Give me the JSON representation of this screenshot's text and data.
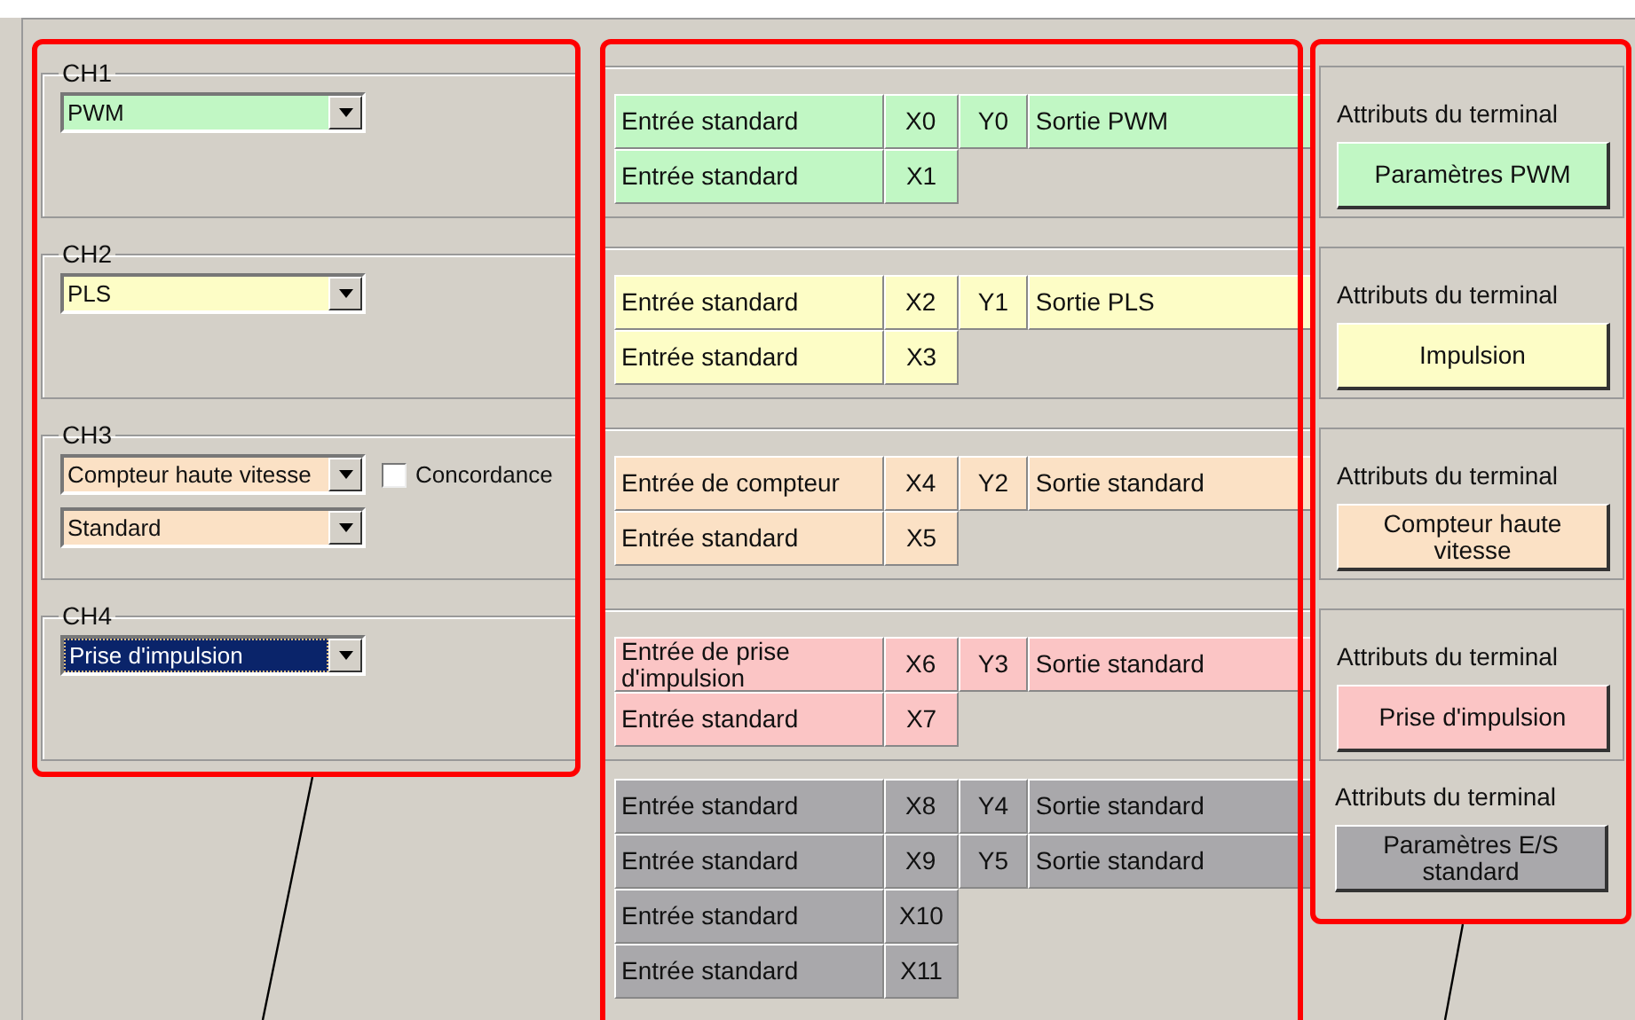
{
  "channels": [
    {
      "name": "CH1",
      "color": "#c1f7c4",
      "selects": [
        {
          "value": "PWM",
          "focused": false
        }
      ],
      "pins": [
        {
          "input": "Entrée standard",
          "x": "X0",
          "y": "Y0",
          "output": "Sortie PWM"
        },
        {
          "input": "Entrée standard",
          "x": "X1"
        }
      ],
      "attributes_label": "Attributs du terminal",
      "button": "Paramètres PWM"
    },
    {
      "name": "CH2",
      "color": "#fdfdc6",
      "selects": [
        {
          "value": "PLS",
          "focused": false
        }
      ],
      "pins": [
        {
          "input": "Entrée standard",
          "x": "X2",
          "y": "Y1",
          "output": "Sortie PLS"
        },
        {
          "input": "Entrée standard",
          "x": "X3"
        }
      ],
      "attributes_label": "Attributs du terminal",
      "button": "Impulsion"
    },
    {
      "name": "CH3",
      "color": "#fbe1c5",
      "selects": [
        {
          "value": "Compteur haute vitesse",
          "focused": false
        },
        {
          "value": "Standard",
          "focused": false
        }
      ],
      "checkbox": {
        "label": "Concordance",
        "checked": false
      },
      "pins": [
        {
          "input": "Entrée de compteur",
          "x": "X4",
          "y": "Y2",
          "output": "Sortie standard"
        },
        {
          "input": "Entrée standard",
          "x": "X5"
        }
      ],
      "attributes_label": "Attributs du terminal",
      "button": "Compteur haute vitesse"
    },
    {
      "name": "CH4",
      "color": "#fbc5c5",
      "selects": [
        {
          "value": "Prise d'impulsion",
          "focused": true
        }
      ],
      "pins": [
        {
          "input": "Entrée de prise d'impulsion",
          "x": "X6",
          "y": "Y3",
          "output": "Sortie standard"
        },
        {
          "input": "Entrée standard",
          "x": "X7"
        }
      ],
      "attributes_label": "Attributs du terminal",
      "button": "Prise d'impulsion"
    }
  ],
  "standard_io": {
    "color": "#a9a8ab",
    "pins": [
      {
        "input": "Entrée standard",
        "x": "X8",
        "y": "Y4",
        "output": "Sortie standard"
      },
      {
        "input": "Entrée standard",
        "x": "X9",
        "y": "Y5",
        "output": "Sortie standard"
      },
      {
        "input": "Entrée standard",
        "x": "X10"
      },
      {
        "input": "Entrée standard",
        "x": "X11"
      }
    ],
    "attributes_label": "Attributs du terminal",
    "button": "Paramètres E/S standard"
  }
}
